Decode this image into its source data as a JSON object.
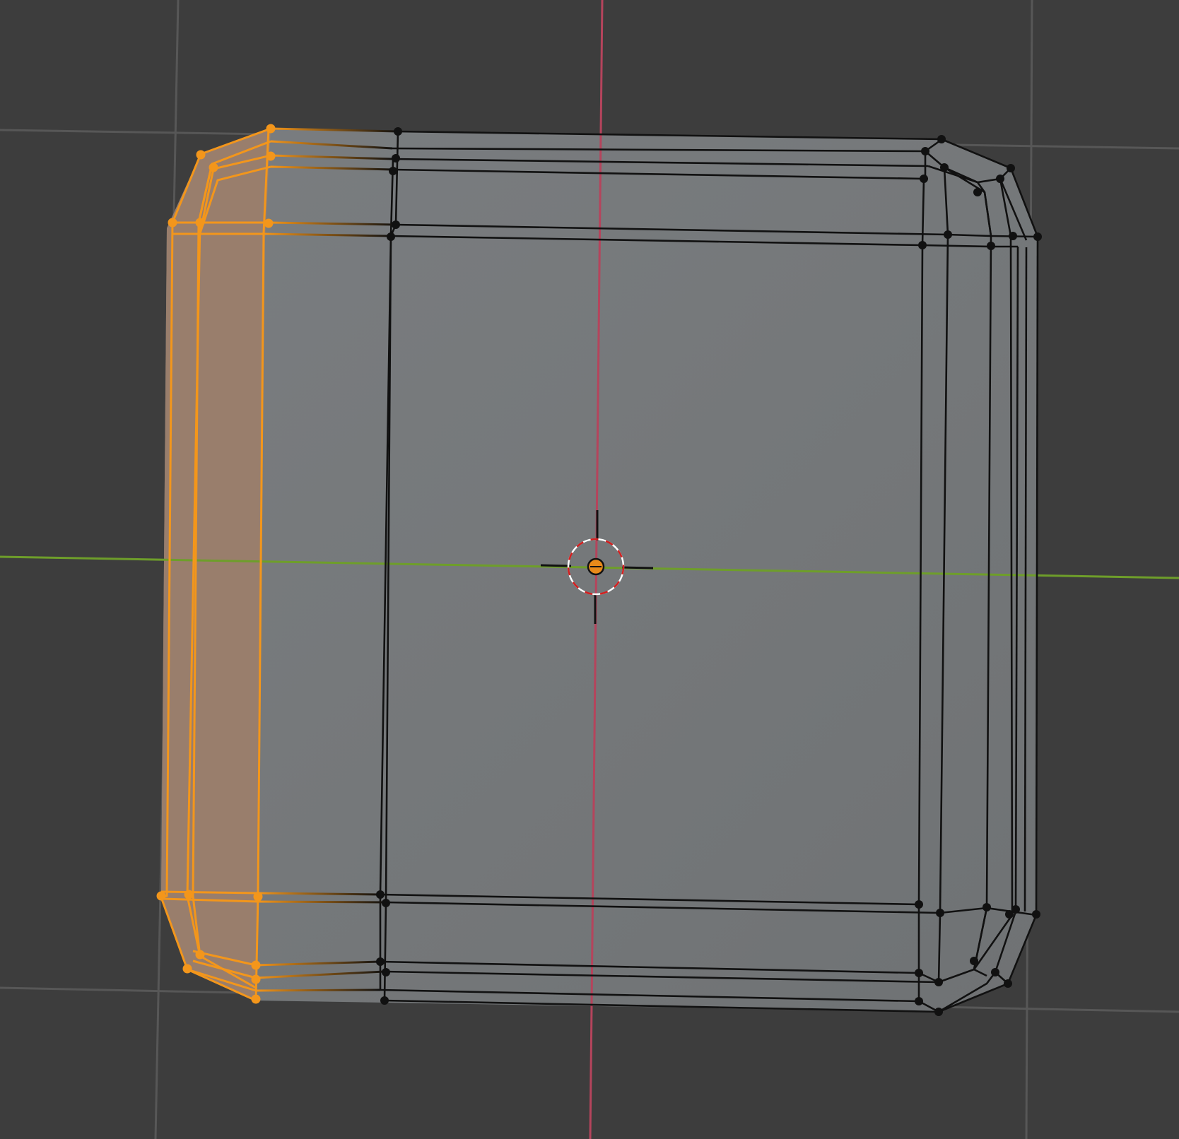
{
  "viewport": {
    "mode": "edit-mesh",
    "view": "top-orthographic",
    "colors": {
      "background": "#3d3d3d",
      "grid_line": "#575757",
      "x_axis": "#b5445c",
      "y_axis": "#6e9e2a",
      "mesh_face": "#747779",
      "mesh_edge": "#111111",
      "selected": "#f3961b",
      "selected_face": "#9b7e6c",
      "cursor_red": "#d41f1f",
      "cursor_white": "#ffffff",
      "origin": "#e88a1a"
    }
  },
  "selection": {
    "selected_region": "left-side-faces",
    "icon": "vertex-dot"
  },
  "cursor_3d": {
    "icon": "crosshair-icon"
  },
  "object_origin": {
    "icon": "origin-dot-icon"
  }
}
